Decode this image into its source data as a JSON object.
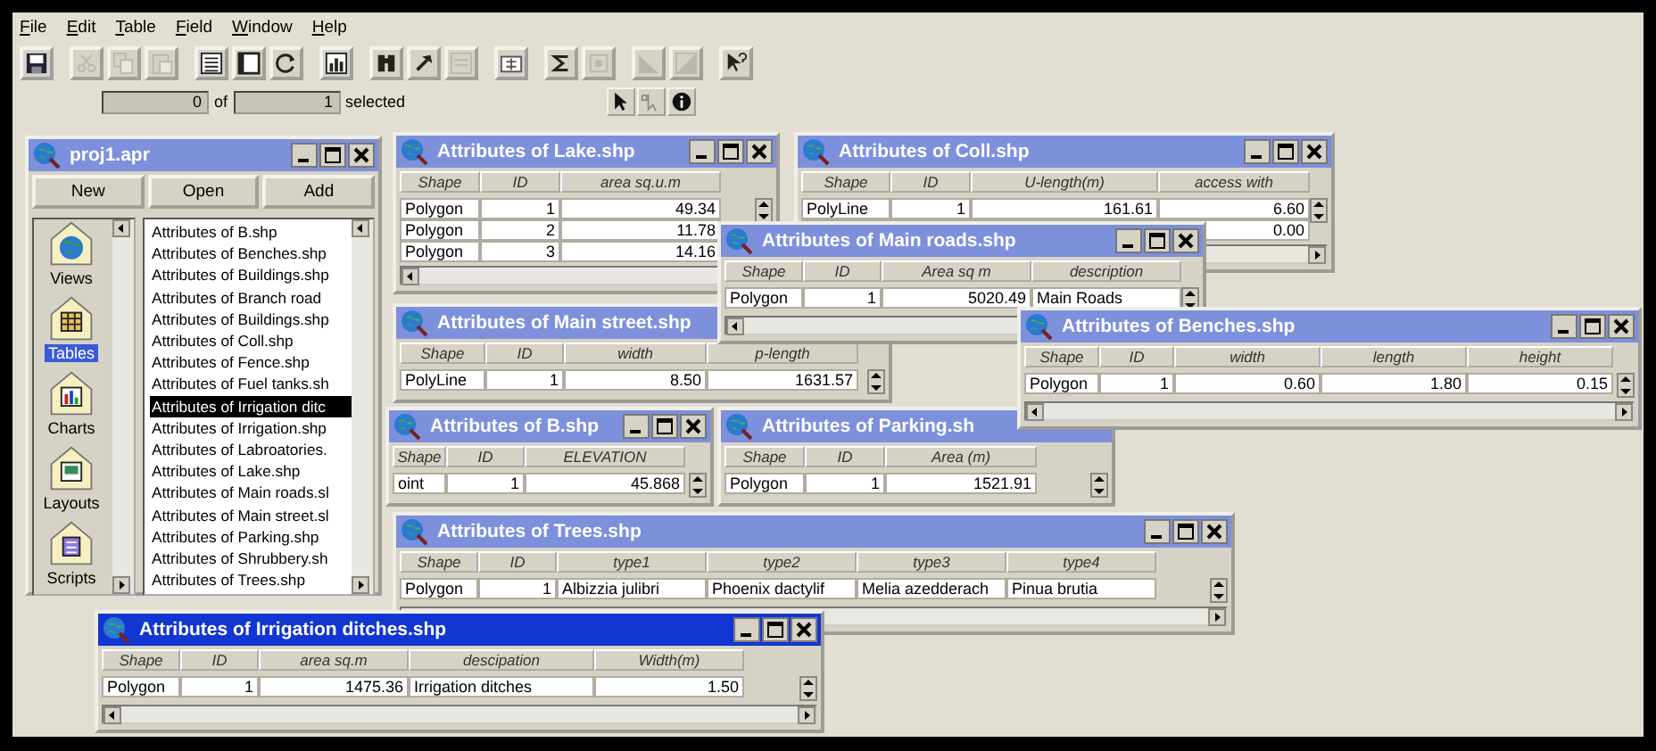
{
  "menu": [
    "File",
    "Edit",
    "Table",
    "Field",
    "Window",
    "Help"
  ],
  "toolbar": [
    [
      {
        "kind": "save",
        "disabled": false
      }
    ],
    [
      {
        "kind": "cut",
        "disabled": true
      },
      {
        "kind": "copy",
        "disabled": true
      },
      {
        "kind": "paste",
        "disabled": true
      }
    ],
    [
      {
        "kind": "table",
        "disabled": false
      },
      {
        "kind": "page",
        "disabled": false
      },
      {
        "kind": "refresh",
        "disabled": false
      }
    ],
    [
      {
        "kind": "chart",
        "disabled": false
      }
    ],
    [
      {
        "kind": "find",
        "disabled": false
      },
      {
        "kind": "query",
        "disabled": false
      },
      {
        "kind": "promote",
        "disabled": true
      }
    ],
    [
      {
        "kind": "calc",
        "disabled": false
      }
    ],
    [
      {
        "kind": "sum",
        "disabled": false
      },
      {
        "kind": "summary",
        "disabled": true
      }
    ],
    [
      {
        "kind": "shade",
        "disabled": true
      },
      {
        "kind": "shade2",
        "disabled": true
      }
    ],
    [
      {
        "kind": "help",
        "disabled": false
      }
    ]
  ],
  "selection": {
    "selected": "0",
    "of": "of",
    "total": "1",
    "label": "selected"
  },
  "tools": [
    {
      "kind": "pointer"
    },
    {
      "kind": "vertex"
    },
    {
      "kind": "info"
    }
  ],
  "project": {
    "title": "proj1.apr",
    "buttons": [
      "New",
      "Open",
      "Add"
    ],
    "categories": [
      {
        "label": "Views",
        "kind": "views",
        "selected": false
      },
      {
        "label": "Tables",
        "kind": "tables",
        "selected": true
      },
      {
        "label": "Charts",
        "kind": "charts",
        "selected": false
      },
      {
        "label": "Layouts",
        "kind": "layouts",
        "selected": false
      },
      {
        "label": "Scripts",
        "kind": "scripts",
        "selected": false
      }
    ],
    "documents": [
      {
        "label": "Attributes of B.shp",
        "selected": false
      },
      {
        "label": "Attributes of Benches.shp",
        "selected": false
      },
      {
        "label": "Attributes of Buildings.shp",
        "selected": false
      },
      {
        "label": "Attributes of Branch  road",
        "selected": false
      },
      {
        "label": "Attributes of Buildings.shp",
        "selected": false
      },
      {
        "label": "Attributes of Coll.shp",
        "selected": false
      },
      {
        "label": "Attributes of Fence.shp",
        "selected": false
      },
      {
        "label": "Attributes of Fuel tanks.sh",
        "selected": false
      },
      {
        "label": "Attributes of Irrigation ditc",
        "selected": true
      },
      {
        "label": "Attributes of Irrigation.shp",
        "selected": false
      },
      {
        "label": "Attributes of Labroatories.",
        "selected": false
      },
      {
        "label": "Attributes of Lake.shp",
        "selected": false
      },
      {
        "label": "Attributes of Main roads.sl",
        "selected": false
      },
      {
        "label": "Attributes of Main street.sl",
        "selected": false
      },
      {
        "label": "Attributes of Parking.shp",
        "selected": false
      },
      {
        "label": "Attributes of Shrubbery.sh",
        "selected": false
      },
      {
        "label": "Attributes of Trees.shp",
        "selected": false
      }
    ]
  },
  "tables": [
    {
      "title": "Attributes of Lake.shp",
      "active": false,
      "controls": true,
      "columns": [
        {
          "label": "Shape",
          "kind": "text"
        },
        {
          "label": "ID",
          "kind": "number"
        },
        {
          "label": "area sq.u.m",
          "kind": "number"
        }
      ],
      "rows": [
        [
          "Polygon",
          "1",
          "49.34"
        ],
        [
          "Polygon",
          "2",
          "11.78"
        ],
        [
          "Polygon",
          "3",
          "14.16"
        ]
      ]
    },
    {
      "title": "Attributes of Coll.shp",
      "active": false,
      "controls": true,
      "columns": [
        {
          "label": "Shape",
          "kind": "text"
        },
        {
          "label": "ID",
          "kind": "number"
        },
        {
          "label": "U-length(m)",
          "kind": "number"
        },
        {
          "label": "access with",
          "kind": "number"
        }
      ],
      "rows": [
        [
          "PolyLine",
          "1",
          "161.61",
          "6.60"
        ],
        [
          null,
          null,
          null,
          "0.00"
        ]
      ]
    },
    {
      "title": "Attributes of Main street.shp",
      "active": false,
      "columns": [
        {
          "label": "Shape",
          "kind": "text"
        },
        {
          "label": "ID",
          "kind": "number"
        },
        {
          "label": "width",
          "kind": "number"
        },
        {
          "label": "p-length",
          "kind": "number"
        }
      ],
      "rows": [
        [
          "PolyLine",
          "1",
          "8.50",
          "1631.57"
        ]
      ]
    },
    {
      "title": "Attributes of Main roads.shp",
      "active": false,
      "controls": true,
      "columns": [
        {
          "label": "Shape",
          "kind": "text"
        },
        {
          "label": "ID",
          "kind": "number"
        },
        {
          "label": "Area sq m",
          "kind": "number"
        },
        {
          "label": "description",
          "kind": "text"
        }
      ],
      "rows": [
        [
          "Polygon",
          "1",
          "5020.49",
          "Main Roads"
        ]
      ]
    },
    {
      "title": "Attributes of B.shp",
      "active": false,
      "controls": true,
      "columns": [
        {
          "label": "Shape",
          "kind": "text"
        },
        {
          "label": "ID",
          "kind": "number"
        },
        {
          "label": "ELEVATION",
          "kind": "number"
        }
      ],
      "rows": [
        [
          "oint",
          "1",
          "45.868"
        ]
      ]
    },
    {
      "title": "Attributes of Parking.sh",
      "active": false,
      "columns": [
        {
          "label": "Shape",
          "kind": "text"
        },
        {
          "label": "ID",
          "kind": "number"
        },
        {
          "label": "Area (m)",
          "kind": "number"
        }
      ],
      "rows": [
        [
          "Polygon",
          "1",
          "1521.91"
        ]
      ]
    },
    {
      "title": "Attributes of Benches.shp",
      "active": false,
      "controls": true,
      "columns": [
        {
          "label": "Shape",
          "kind": "text"
        },
        {
          "label": "ID",
          "kind": "number"
        },
        {
          "label": "width",
          "kind": "number"
        },
        {
          "label": "length",
          "kind": "number"
        },
        {
          "label": "height",
          "kind": "number"
        }
      ],
      "rows": [
        [
          "Polygon",
          "1",
          "0.60",
          "1.80",
          "0.15"
        ]
      ]
    },
    {
      "title": "Attributes of Trees.shp",
      "active": false,
      "controls": true,
      "columns": [
        {
          "label": "Shape",
          "kind": "text"
        },
        {
          "label": "ID",
          "kind": "number"
        },
        {
          "label": "type1",
          "kind": "text"
        },
        {
          "label": "type2",
          "kind": "text"
        },
        {
          "label": "type3",
          "kind": "text"
        },
        {
          "label": "type4",
          "kind": "text"
        }
      ],
      "rows": [
        [
          "Polygon",
          "1",
          "Albizzia julibri",
          "Phoenix dactylif",
          "Melia azedderach",
          "Pinua brutia"
        ]
      ]
    },
    {
      "title": "Attributes of Irrigation ditches.shp",
      "active": true,
      "controls": true,
      "columns": [
        {
          "label": "Shape",
          "kind": "text"
        },
        {
          "label": "ID",
          "kind": "number"
        },
        {
          "label": "area sq.m",
          "kind": "number"
        },
        {
          "label": "descipation",
          "kind": "text"
        },
        {
          "label": "Width(m)",
          "kind": "number"
        }
      ],
      "rows": [
        [
          "Polygon",
          "1",
          "1475.36",
          "Irrigation ditches",
          "1.50"
        ]
      ]
    }
  ]
}
